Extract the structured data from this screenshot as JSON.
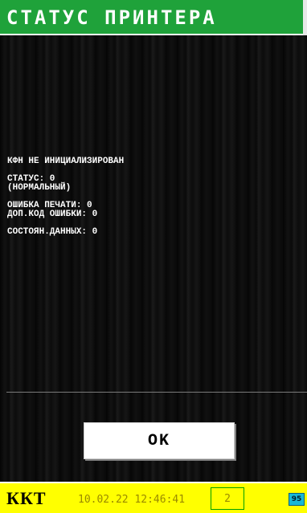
{
  "header": {
    "title": "СТАТУС ПРИНТЕРА"
  },
  "status": {
    "fn_state": "КФН НЕ ИНИЦИАЛИЗИРОВАН",
    "status_line": "СТАТУС: 0",
    "status_desc": "(НОРМАЛЬНЫЙ)",
    "print_error": "ОШИБКА ПЕЧАТИ: 0",
    "extra_error_code": "ДОП.КОД ОШИБКИ: 0",
    "data_state": "СОСТОЯН.ДАННЫХ: 0"
  },
  "actions": {
    "ok_label": "OK"
  },
  "status_bar": {
    "device_label": "ККТ",
    "datetime": "10.02.22 12:46:41",
    "counter": "2",
    "battery": "95"
  },
  "colors": {
    "title_bg": "#1fa23a",
    "status_bar_bg": "#ffff00",
    "battery": "#18b8d8"
  }
}
